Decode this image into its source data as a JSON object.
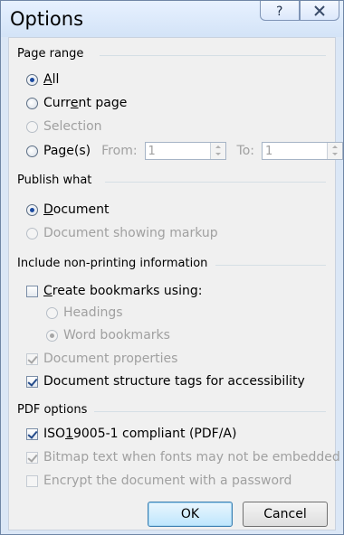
{
  "window": {
    "title": "Options",
    "help_symbol": "?",
    "close_symbol": "✕"
  },
  "page_range": {
    "label": "Page range",
    "all": {
      "prefix": "",
      "underline": "A",
      "suffix": "ll",
      "checked": true
    },
    "current_page": {
      "prefix": "Curr",
      "underline": "e",
      "suffix": "nt page",
      "checked": false
    },
    "selection": {
      "label": "Selection",
      "checked": false
    },
    "pages": {
      "prefix": "Pa",
      "underline": "g",
      "suffix": "e(s)",
      "checked": false
    },
    "from_label": "From:",
    "from_value": "1",
    "to_label": "To:",
    "to_value": "1"
  },
  "publish_what": {
    "label": "Publish what",
    "document": {
      "prefix": "",
      "underline": "D",
      "suffix": "ocument",
      "checked": true
    },
    "document_markup": {
      "label": "Document showing markup",
      "checked": false
    }
  },
  "non_printing": {
    "label": "Include non-printing information",
    "create_bookmarks": {
      "prefix": "",
      "underline": "C",
      "suffix": "reate bookmarks using:",
      "checked": false
    },
    "headings": {
      "label": "Headings",
      "checked": false
    },
    "word_bookmarks": {
      "label": "Word bookmarks",
      "checked": true
    },
    "document_properties": {
      "label": "Document properties",
      "checked": true
    },
    "structure_tags": {
      "prefix": "Document structure tags for accessibility",
      "checked": true
    }
  },
  "pdf_options": {
    "label": "PDF options",
    "iso": {
      "prefix": "ISO ",
      "underline": "1",
      "suffix": "9005-1 compliant (PDF/A)",
      "checked": true
    },
    "bitmap": {
      "label": "Bitmap text when fonts may not be embedded",
      "checked": true
    },
    "encrypt": {
      "label": "Encrypt the document with a password",
      "checked": false
    }
  },
  "buttons": {
    "ok": "OK",
    "cancel": "Cancel"
  }
}
